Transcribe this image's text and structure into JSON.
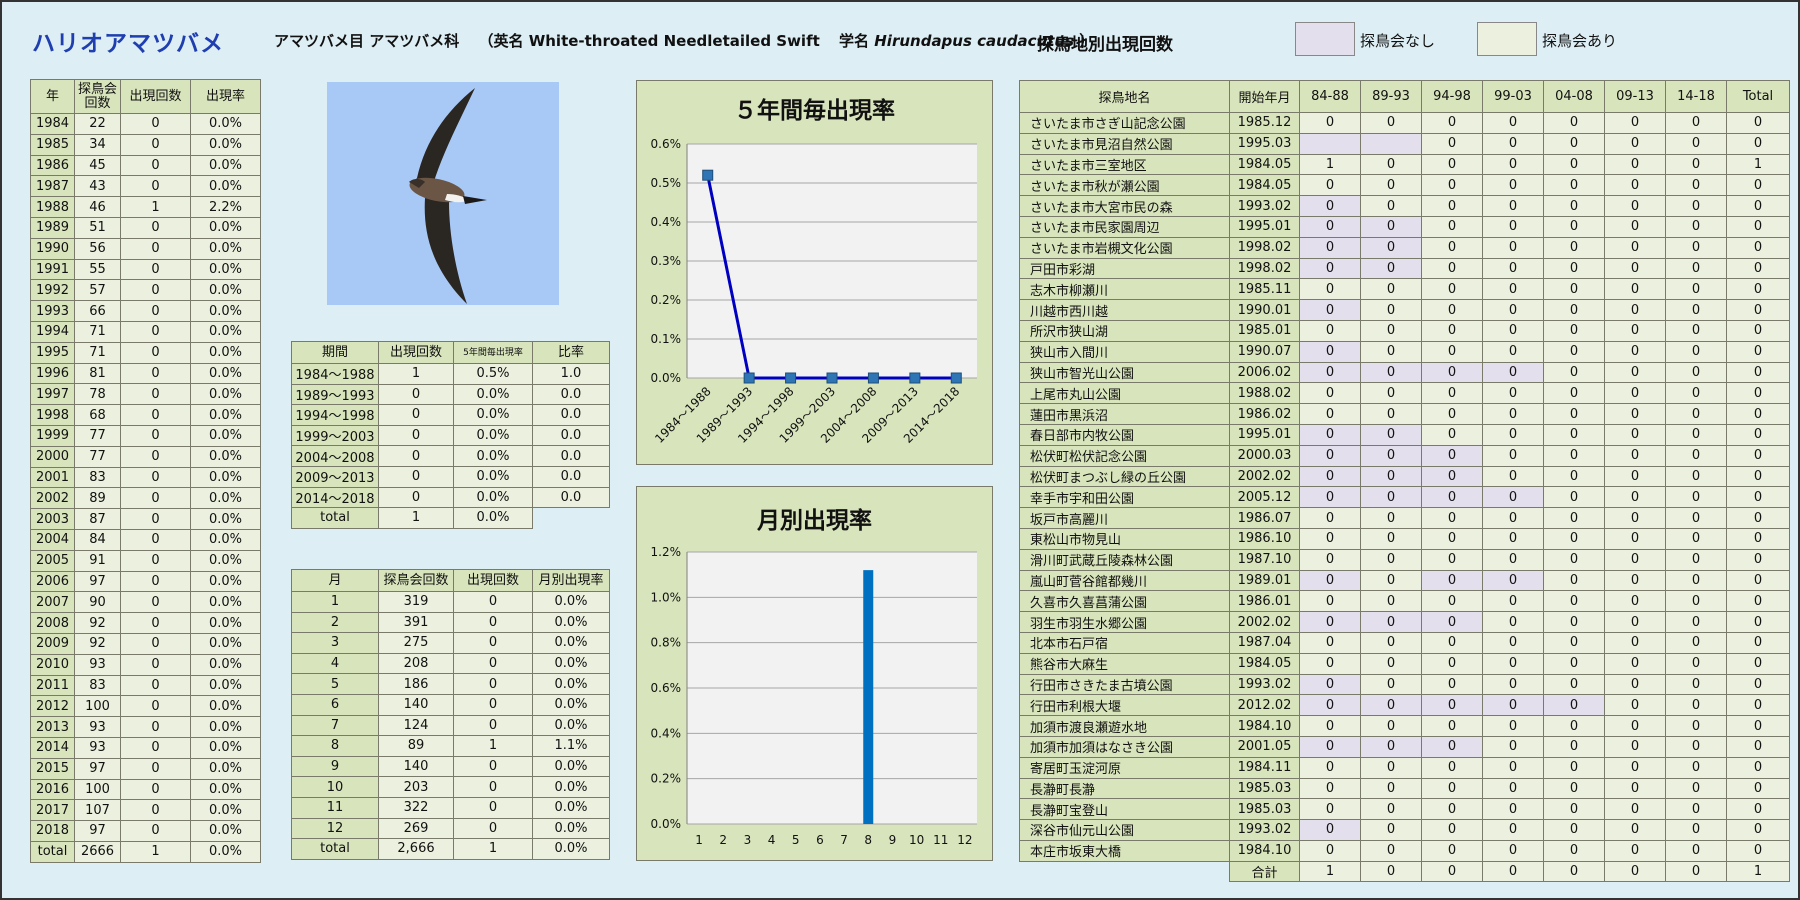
{
  "header": {
    "species_name": "ハリオアマツバメ",
    "order_family": "アマツバメ目 アマツバメ科",
    "en_open": "（英名 ",
    "english_name": "White-throated Needletailed Swift",
    "sci_prefix": "学名 ",
    "scientific_name": "Hirundapus caudacutus",
    "sci_close": " ）",
    "site_table_title": "探鳥地別出現回数",
    "legend_none": "探鳥会なし",
    "legend_held": "探鳥会あり"
  },
  "colors": {
    "no_event": "#e4dfec",
    "event": "#ebf1de",
    "header": "#d8e4bc",
    "line": "#0000c0",
    "marker": "#2e75b6",
    "bar": "#0070c0",
    "plot_bg": "#f2f2f2"
  },
  "icons": {
    "photo": "swift-in-flight-photo"
  },
  "yearly": {
    "headers": [
      "年",
      "探鳥会\n回数",
      "出現回数",
      "出現率"
    ],
    "rows": [
      [
        "1984",
        "22",
        "0",
        "0.0%"
      ],
      [
        "1985",
        "34",
        "0",
        "0.0%"
      ],
      [
        "1986",
        "45",
        "0",
        "0.0%"
      ],
      [
        "1987",
        "43",
        "0",
        "0.0%"
      ],
      [
        "1988",
        "46",
        "1",
        "2.2%"
      ],
      [
        "1989",
        "51",
        "0",
        "0.0%"
      ],
      [
        "1990",
        "56",
        "0",
        "0.0%"
      ],
      [
        "1991",
        "55",
        "0",
        "0.0%"
      ],
      [
        "1992",
        "57",
        "0",
        "0.0%"
      ],
      [
        "1993",
        "66",
        "0",
        "0.0%"
      ],
      [
        "1994",
        "71",
        "0",
        "0.0%"
      ],
      [
        "1995",
        "71",
        "0",
        "0.0%"
      ],
      [
        "1996",
        "81",
        "0",
        "0.0%"
      ],
      [
        "1997",
        "78",
        "0",
        "0.0%"
      ],
      [
        "1998",
        "68",
        "0",
        "0.0%"
      ],
      [
        "1999",
        "77",
        "0",
        "0.0%"
      ],
      [
        "2000",
        "77",
        "0",
        "0.0%"
      ],
      [
        "2001",
        "83",
        "0",
        "0.0%"
      ],
      [
        "2002",
        "89",
        "0",
        "0.0%"
      ],
      [
        "2003",
        "87",
        "0",
        "0.0%"
      ],
      [
        "2004",
        "84",
        "0",
        "0.0%"
      ],
      [
        "2005",
        "91",
        "0",
        "0.0%"
      ],
      [
        "2006",
        "97",
        "0",
        "0.0%"
      ],
      [
        "2007",
        "90",
        "0",
        "0.0%"
      ],
      [
        "2008",
        "92",
        "0",
        "0.0%"
      ],
      [
        "2009",
        "92",
        "0",
        "0.0%"
      ],
      [
        "2010",
        "93",
        "0",
        "0.0%"
      ],
      [
        "2011",
        "83",
        "0",
        "0.0%"
      ],
      [
        "2012",
        "100",
        "0",
        "0.0%"
      ],
      [
        "2013",
        "93",
        "0",
        "0.0%"
      ],
      [
        "2014",
        "93",
        "0",
        "0.0%"
      ],
      [
        "2015",
        "97",
        "0",
        "0.0%"
      ],
      [
        "2016",
        "100",
        "0",
        "0.0%"
      ],
      [
        "2017",
        "107",
        "0",
        "0.0%"
      ],
      [
        "2018",
        "97",
        "0",
        "0.0%"
      ],
      [
        "total",
        "2666",
        "1",
        "0.0%"
      ]
    ]
  },
  "period": {
    "headers": [
      "期間",
      "出現回数",
      "5年間毎出現率",
      "比率"
    ],
    "rows": [
      [
        "1984～1988",
        "1",
        "0.5%",
        "1.0"
      ],
      [
        "1989～1993",
        "0",
        "0.0%",
        "0.0"
      ],
      [
        "1994～1998",
        "0",
        "0.0%",
        "0.0"
      ],
      [
        "1999～2003",
        "0",
        "0.0%",
        "0.0"
      ],
      [
        "2004～2008",
        "0",
        "0.0%",
        "0.0"
      ],
      [
        "2009～2013",
        "0",
        "0.0%",
        "0.0"
      ],
      [
        "2014～2018",
        "0",
        "0.0%",
        "0.0"
      ],
      [
        "total",
        "1",
        "0.0%"
      ]
    ]
  },
  "monthly": {
    "headers": [
      "月",
      "探鳥会回数",
      "出現回数",
      "月別出現率"
    ],
    "rows": [
      [
        "1",
        "319",
        "0",
        "0.0%"
      ],
      [
        "2",
        "391",
        "0",
        "0.0%"
      ],
      [
        "3",
        "275",
        "0",
        "0.0%"
      ],
      [
        "4",
        "208",
        "0",
        "0.0%"
      ],
      [
        "5",
        "186",
        "0",
        "0.0%"
      ],
      [
        "6",
        "140",
        "0",
        "0.0%"
      ],
      [
        "7",
        "124",
        "0",
        "0.0%"
      ],
      [
        "8",
        "89",
        "1",
        "1.1%"
      ],
      [
        "9",
        "140",
        "0",
        "0.0%"
      ],
      [
        "10",
        "203",
        "0",
        "0.0%"
      ],
      [
        "11",
        "322",
        "0",
        "0.0%"
      ],
      [
        "12",
        "269",
        "0",
        "0.0%"
      ],
      [
        "total",
        "2,666",
        "1",
        "0.0%"
      ]
    ]
  },
  "sites": {
    "headers": [
      "探鳥地名",
      "開始年月",
      "84-88",
      "89-93",
      "94-98",
      "99-03",
      "04-08",
      "09-13",
      "14-18",
      "Total"
    ],
    "rows": [
      {
        "name": "さいたま市さぎ山記念公園",
        "start": "1985.12",
        "v": [
          "0",
          "0",
          "0",
          "0",
          "0",
          "0",
          "0",
          "0"
        ],
        "none": []
      },
      {
        "name": "さいたま市見沼自然公園",
        "start": "1995.03",
        "v": [
          "",
          "",
          "0",
          "0",
          "0",
          "0",
          "0",
          "0"
        ],
        "none": [
          0,
          1
        ]
      },
      {
        "name": "さいたま市三室地区",
        "start": "1984.05",
        "v": [
          "1",
          "0",
          "0",
          "0",
          "0",
          "0",
          "0",
          "1"
        ],
        "none": []
      },
      {
        "name": "さいたま市秋が瀬公園",
        "start": "1984.05",
        "v": [
          "0",
          "0",
          "0",
          "0",
          "0",
          "0",
          "0",
          "0"
        ],
        "none": []
      },
      {
        "name": "さいたま市大宮市民の森",
        "start": "1993.02",
        "v": [
          "0",
          "0",
          "0",
          "0",
          "0",
          "0",
          "0",
          "0"
        ],
        "none": [
          0
        ]
      },
      {
        "name": "さいたま市民家園周辺",
        "start": "1995.01",
        "v": [
          "0",
          "0",
          "0",
          "0",
          "0",
          "0",
          "0",
          "0"
        ],
        "none": [
          0,
          1
        ]
      },
      {
        "name": "さいたま市岩槻文化公園",
        "start": "1998.02",
        "v": [
          "0",
          "0",
          "0",
          "0",
          "0",
          "0",
          "0",
          "0"
        ],
        "none": [
          0,
          1
        ]
      },
      {
        "name": "戸田市彩湖",
        "start": "1998.02",
        "v": [
          "0",
          "0",
          "0",
          "0",
          "0",
          "0",
          "0",
          "0"
        ],
        "none": [
          0,
          1
        ]
      },
      {
        "name": "志木市柳瀬川",
        "start": "1985.11",
        "v": [
          "0",
          "0",
          "0",
          "0",
          "0",
          "0",
          "0",
          "0"
        ],
        "none": []
      },
      {
        "name": "川越市西川越",
        "start": "1990.01",
        "v": [
          "0",
          "0",
          "0",
          "0",
          "0",
          "0",
          "0",
          "0"
        ],
        "none": [
          0
        ]
      },
      {
        "name": "所沢市狭山湖",
        "start": "1985.01",
        "v": [
          "0",
          "0",
          "0",
          "0",
          "0",
          "0",
          "0",
          "0"
        ],
        "none": []
      },
      {
        "name": "狭山市入間川",
        "start": "1990.07",
        "v": [
          "0",
          "0",
          "0",
          "0",
          "0",
          "0",
          "0",
          "0"
        ],
        "none": [
          0
        ]
      },
      {
        "name": "狭山市智光山公園",
        "start": "2006.02",
        "v": [
          "0",
          "0",
          "0",
          "0",
          "0",
          "0",
          "0",
          "0"
        ],
        "none": [
          0,
          1,
          2,
          3
        ]
      },
      {
        "name": "上尾市丸山公園",
        "start": "1988.02",
        "v": [
          "0",
          "0",
          "0",
          "0",
          "0",
          "0",
          "0",
          "0"
        ],
        "none": []
      },
      {
        "name": "蓮田市黒浜沼",
        "start": "1986.02",
        "v": [
          "0",
          "0",
          "0",
          "0",
          "0",
          "0",
          "0",
          "0"
        ],
        "none": []
      },
      {
        "name": "春日部市内牧公園",
        "start": "1995.01",
        "v": [
          "0",
          "0",
          "0",
          "0",
          "0",
          "0",
          "0",
          "0"
        ],
        "none": [
          0,
          1
        ]
      },
      {
        "name": "松伏町松伏記念公園",
        "start": "2000.03",
        "v": [
          "0",
          "0",
          "0",
          "0",
          "0",
          "0",
          "0",
          "0"
        ],
        "none": [
          0,
          1,
          2
        ]
      },
      {
        "name": "松伏町まつぶし緑の丘公園",
        "start": "2002.02",
        "v": [
          "0",
          "0",
          "0",
          "0",
          "0",
          "0",
          "0",
          "0"
        ],
        "none": [
          0,
          1,
          2
        ]
      },
      {
        "name": "幸手市宇和田公園",
        "start": "2005.12",
        "v": [
          "0",
          "0",
          "0",
          "0",
          "0",
          "0",
          "0",
          "0"
        ],
        "none": [
          0,
          1,
          2,
          3
        ]
      },
      {
        "name": "坂戸市高麗川",
        "start": "1986.07",
        "v": [
          "0",
          "0",
          "0",
          "0",
          "0",
          "0",
          "0",
          "0"
        ],
        "none": []
      },
      {
        "name": "東松山市物見山",
        "start": "1986.10",
        "v": [
          "0",
          "0",
          "0",
          "0",
          "0",
          "0",
          "0",
          "0"
        ],
        "none": []
      },
      {
        "name": "滑川町武蔵丘陵森林公園",
        "start": "1987.10",
        "v": [
          "0",
          "0",
          "0",
          "0",
          "0",
          "0",
          "0",
          "0"
        ],
        "none": []
      },
      {
        "name": "嵐山町菅谷館都幾川",
        "start": "1989.01",
        "v": [
          "0",
          "0",
          "0",
          "0",
          "0",
          "0",
          "0",
          "0"
        ],
        "none": [
          0,
          2,
          3
        ]
      },
      {
        "name": "久喜市久喜菖蒲公園",
        "start": "1986.01",
        "v": [
          "0",
          "0",
          "0",
          "0",
          "0",
          "0",
          "0",
          "0"
        ],
        "none": []
      },
      {
        "name": "羽生市羽生水郷公園",
        "start": "2002.02",
        "v": [
          "0",
          "0",
          "0",
          "0",
          "0",
          "0",
          "0",
          "0"
        ],
        "none": [
          0,
          1,
          2
        ]
      },
      {
        "name": "北本市石戸宿",
        "start": "1987.04",
        "v": [
          "0",
          "0",
          "0",
          "0",
          "0",
          "0",
          "0",
          "0"
        ],
        "none": []
      },
      {
        "name": "熊谷市大麻生",
        "start": "1984.05",
        "v": [
          "0",
          "0",
          "0",
          "0",
          "0",
          "0",
          "0",
          "0"
        ],
        "none": []
      },
      {
        "name": "行田市さきたま古墳公園",
        "start": "1993.02",
        "v": [
          "0",
          "0",
          "0",
          "0",
          "0",
          "0",
          "0",
          "0"
        ],
        "none": [
          0
        ]
      },
      {
        "name": "行田市利根大堰",
        "start": "2012.02",
        "v": [
          "0",
          "0",
          "0",
          "0",
          "0",
          "0",
          "0",
          "0"
        ],
        "none": [
          0,
          1,
          2,
          3,
          4
        ]
      },
      {
        "name": "加須市渡良瀬遊水地",
        "start": "1984.10",
        "v": [
          "0",
          "0",
          "0",
          "0",
          "0",
          "0",
          "0",
          "0"
        ],
        "none": []
      },
      {
        "name": "加須市加須はなさき公園",
        "start": "2001.05",
        "v": [
          "0",
          "0",
          "0",
          "0",
          "0",
          "0",
          "0",
          "0"
        ],
        "none": [
          0,
          1,
          2
        ]
      },
      {
        "name": "寄居町玉淀河原",
        "start": "1984.11",
        "v": [
          "0",
          "0",
          "0",
          "0",
          "0",
          "0",
          "0",
          "0"
        ],
        "none": []
      },
      {
        "name": "長瀞町長瀞",
        "start": "1985.03",
        "v": [
          "0",
          "0",
          "0",
          "0",
          "0",
          "0",
          "0",
          "0"
        ],
        "none": []
      },
      {
        "name": "長瀞町宝登山",
        "start": "1985.03",
        "v": [
          "0",
          "0",
          "0",
          "0",
          "0",
          "0",
          "0",
          "0"
        ],
        "none": []
      },
      {
        "name": "深谷市仙元山公園",
        "start": "1993.02",
        "v": [
          "0",
          "0",
          "0",
          "0",
          "0",
          "0",
          "0",
          "0"
        ],
        "none": [
          0
        ]
      },
      {
        "name": "本庄市坂東大橋",
        "start": "1984.10",
        "v": [
          "0",
          "0",
          "0",
          "0",
          "0",
          "0",
          "0",
          "0"
        ],
        "none": []
      }
    ],
    "total_label": "合計",
    "totals": [
      "1",
      "0",
      "0",
      "0",
      "0",
      "0",
      "0",
      "1"
    ]
  },
  "chart_data": [
    {
      "type": "line",
      "title": "５年間毎出現率",
      "categories": [
        "1984～1988",
        "1989～1993",
        "1994～1998",
        "1999～2003",
        "2004～2008",
        "2009～2013",
        "2014～2018"
      ],
      "values": [
        0.52,
        0,
        0,
        0,
        0,
        0,
        0
      ],
      "unit": "%",
      "ylim": [
        0,
        0.6
      ],
      "yticks": [
        "0.0%",
        "0.1%",
        "0.2%",
        "0.3%",
        "0.4%",
        "0.5%",
        "0.6%"
      ],
      "grid": true
    },
    {
      "type": "bar",
      "title": "月別出現率",
      "categories": [
        "1",
        "2",
        "3",
        "4",
        "5",
        "6",
        "7",
        "8",
        "9",
        "10",
        "11",
        "12"
      ],
      "values": [
        0,
        0,
        0,
        0,
        0,
        0,
        0,
        1.12,
        0,
        0,
        0,
        0
      ],
      "unit": "%",
      "ylim": [
        0,
        1.2
      ],
      "yticks": [
        "0.0%",
        "0.2%",
        "0.4%",
        "0.6%",
        "0.8%",
        "1.0%",
        "1.2%"
      ],
      "grid": true
    }
  ]
}
